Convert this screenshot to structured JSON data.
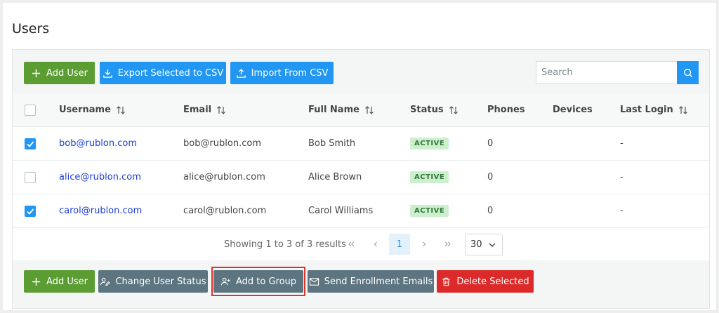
{
  "page": {
    "title": "Users"
  },
  "toolbar": {
    "add_user": "Add User",
    "export_csv": "Export Selected to CSV",
    "import_csv": "Import From CSV",
    "search_placeholder": "Search"
  },
  "table": {
    "headers": {
      "username": "Username",
      "email": "Email",
      "full_name": "Full Name",
      "status": "Status",
      "phones": "Phones",
      "devices": "Devices",
      "last_login": "Last Login"
    },
    "rows": [
      {
        "checked": true,
        "username": "bob@rublon.com",
        "email": "bob@rublon.com",
        "full_name": "Bob Smith",
        "status": "ACTIVE",
        "phones": "0",
        "devices": "",
        "last_login": "-"
      },
      {
        "checked": false,
        "username": "alice@rublon.com",
        "email": "alice@rublon.com",
        "full_name": "Alice Brown",
        "status": "ACTIVE",
        "phones": "0",
        "devices": "",
        "last_login": "-"
      },
      {
        "checked": true,
        "username": "carol@rublon.com",
        "email": "carol@rublon.com",
        "full_name": "Carol Williams",
        "status": "ACTIVE",
        "phones": "0",
        "devices": "",
        "last_login": "-"
      }
    ]
  },
  "pagination": {
    "info": "Showing 1 to 3 of 3 results",
    "first": "«",
    "prev": "‹",
    "current_page": "1",
    "next": "›",
    "last": "»",
    "page_size": "30"
  },
  "bulk_actions": {
    "add_user": "Add User",
    "change_status": "Change User Status",
    "add_to_group": "Add to Group",
    "send_enrollment": "Send Enrollment Emails",
    "delete_selected": "Delete Selected"
  },
  "colors": {
    "green": "#5b9c33",
    "blue": "#2196f3",
    "gray": "#5c7580",
    "red": "#dc2a2a",
    "link": "#1a3fcf",
    "badge_bg": "#cdeecf",
    "highlight": "#e0332b"
  }
}
